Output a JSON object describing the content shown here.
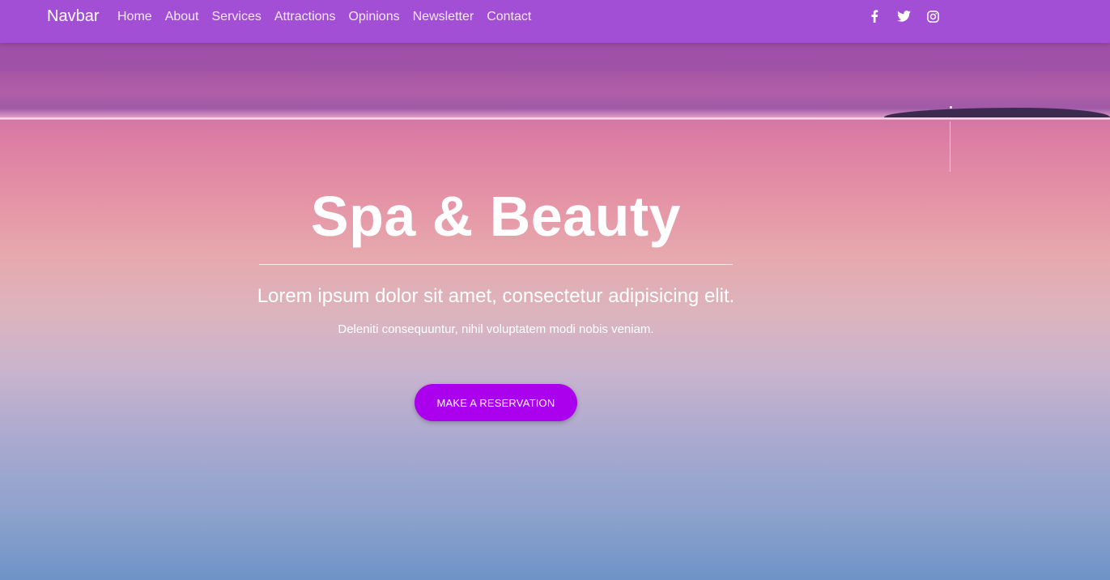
{
  "navbar": {
    "brand": "Navbar",
    "links": [
      {
        "label": "Home"
      },
      {
        "label": "About"
      },
      {
        "label": "Services"
      },
      {
        "label": "Attractions"
      },
      {
        "label": "Opinions"
      },
      {
        "label": "Newsletter"
      },
      {
        "label": "Contact"
      }
    ],
    "social": [
      {
        "icon": "facebook-icon"
      },
      {
        "icon": "twitter-icon"
      },
      {
        "icon": "instagram-icon"
      }
    ],
    "background_color": "#a24fd5"
  },
  "hero": {
    "title": "Spa & Beauty",
    "lead": "Lorem ipsum dolor sit amet, consectetur adipisicing elit.",
    "subtext": "Deleniti consequuntur, nihil voluptatem modi nobis veniam.",
    "cta_label": "MAKE A RESERVATION",
    "cta_color": "#aa00ee"
  }
}
